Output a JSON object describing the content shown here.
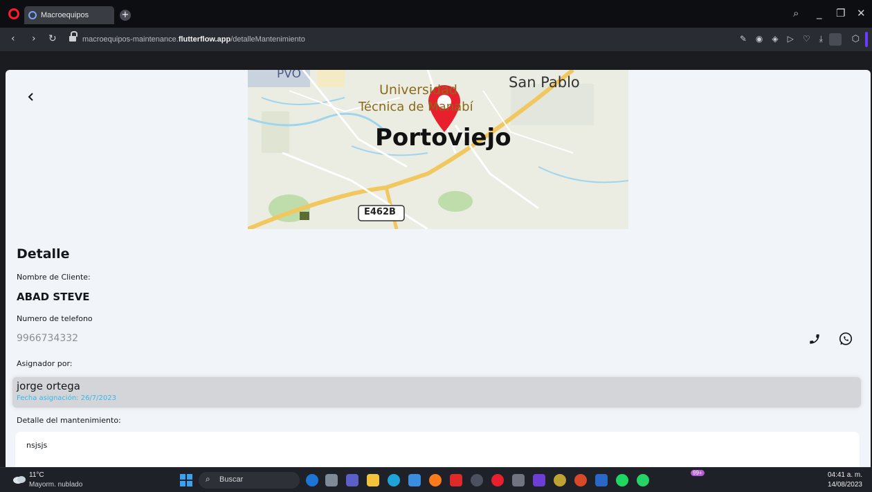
{
  "browser": {
    "tab_title": "Macroequipos",
    "url_prefix": "macroequipos-maintenance.",
    "url_domain": "flutterflow.app",
    "url_path": "/detalleMantenimiento"
  },
  "map": {
    "labels": [
      "PVO",
      "Universidad",
      "Técnica de Manabí",
      "San Pablo",
      "Portoviejo",
      "E462B"
    ],
    "pin_color": "#e8202e"
  },
  "detail": {
    "back_icon": "chevron-left-icon",
    "title": "Detalle",
    "client_label": "Nombre de Cliente:",
    "client_name": "ABAD STEVE",
    "phone_label": "Numero de telefono",
    "phone": "9966734332",
    "assigned_label": "Asignador por:",
    "assigned_name": "jorge ortega",
    "assigned_date": "Fecha asignación: 26/7/2023",
    "description_label": "Detalle del mantenimiento:",
    "description": "nsjsjs",
    "call_icon": "phone-icon",
    "whatsapp_icon": "whatsapp-icon"
  },
  "taskbar": {
    "temperature": "11°C",
    "weather": "Mayorm. nublado",
    "search_placeholder": "Buscar",
    "badge": "99+",
    "time": "04:41 a. m.",
    "date": "14/08/2023"
  },
  "colors": {
    "accent": "#39b7ea",
    "page_bg": "#f1f4f8",
    "assigned_bg": "#d3d5d9"
  }
}
